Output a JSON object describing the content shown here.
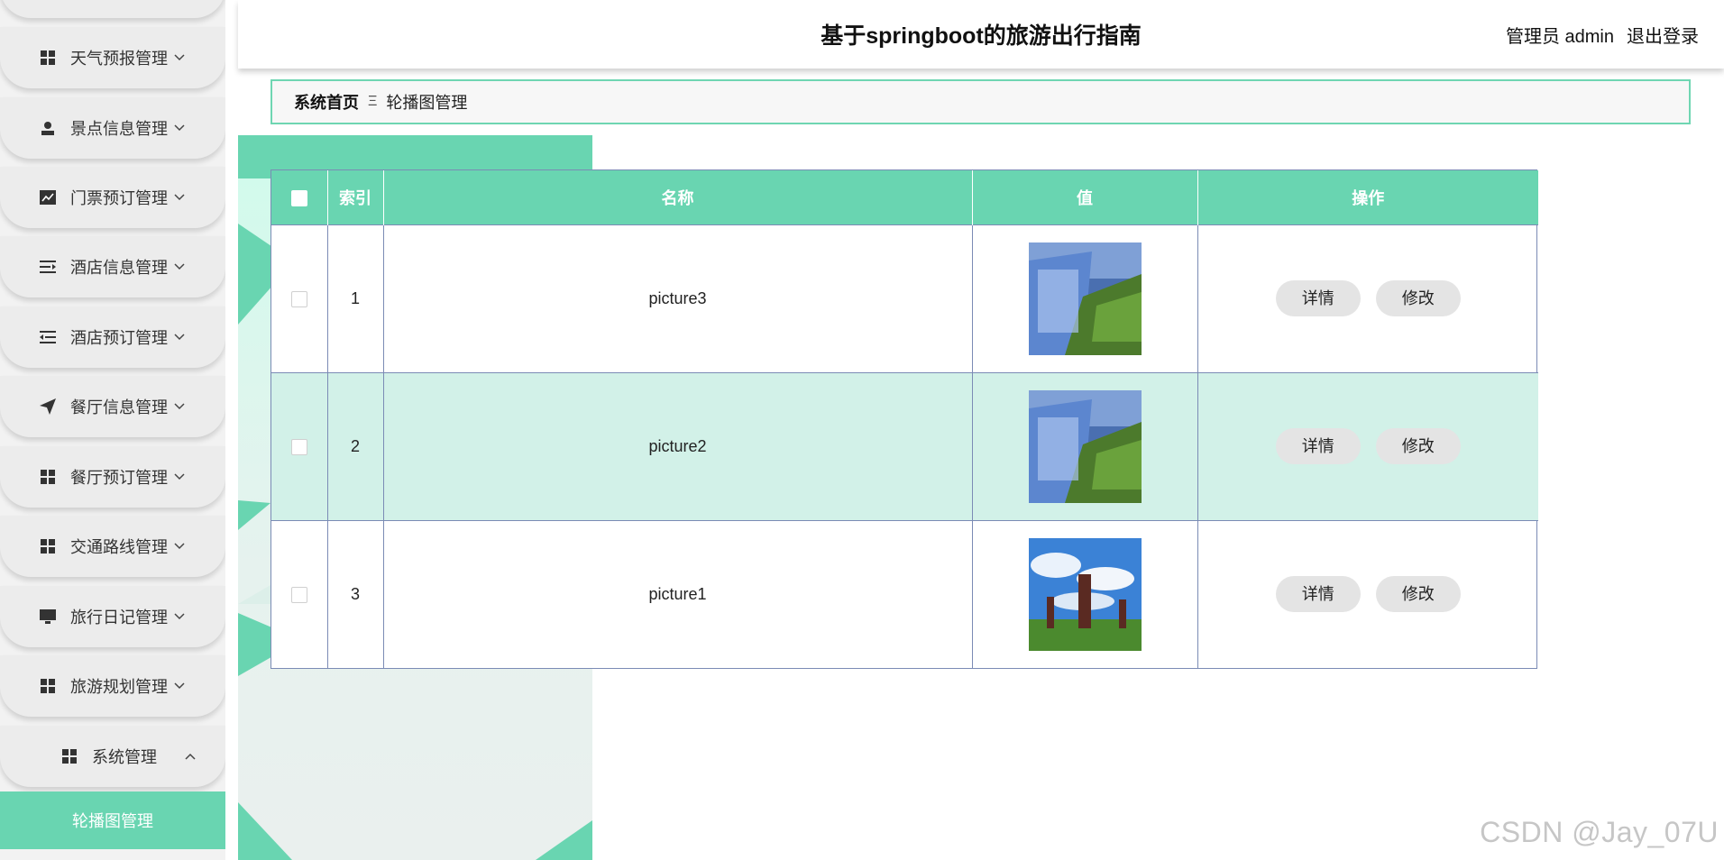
{
  "header": {
    "site_title": "基于springboot的旅游出行指南",
    "user_label": "管理员 admin",
    "logout_label": "退出登录"
  },
  "sidebar": {
    "items": [
      {
        "label": "天气预报管理",
        "icon": "grid-icon"
      },
      {
        "label": "景点信息管理",
        "icon": "user-icon"
      },
      {
        "label": "门票预订管理",
        "icon": "chart-icon"
      },
      {
        "label": "酒店信息管理",
        "icon": "list-indent-icon"
      },
      {
        "label": "酒店预订管理",
        "icon": "list-outdent-icon"
      },
      {
        "label": "餐厅信息管理",
        "icon": "send-icon"
      },
      {
        "label": "餐厅预订管理",
        "icon": "grid-icon"
      },
      {
        "label": "交通路线管理",
        "icon": "grid-icon"
      },
      {
        "label": "旅行日记管理",
        "icon": "monitor-icon"
      },
      {
        "label": "旅游规划管理",
        "icon": "grid-icon"
      },
      {
        "label": "系统管理",
        "icon": "grid-icon",
        "expanded": true
      }
    ],
    "active_sub": {
      "label": "轮播图管理"
    }
  },
  "breadcrumb": {
    "home": "系统首页",
    "separator": "Ξ",
    "current": "轮播图管理"
  },
  "table": {
    "columns": [
      "索引",
      "名称",
      "值",
      "操作"
    ],
    "rows": [
      {
        "index": "1",
        "name": "picture3",
        "image": "waterfall-image"
      },
      {
        "index": "2",
        "name": "picture2",
        "image": "waterfall-image"
      },
      {
        "index": "3",
        "name": "picture1",
        "image": "windmills-image"
      }
    ],
    "actions": {
      "detail": "详情",
      "edit": "修改"
    }
  },
  "watermark": "CSDN @Jay_07U",
  "colors": {
    "accent": "#69d5b1",
    "row_alt": "#d2f1e8",
    "button_bg": "#e4e4e4",
    "border": "#7b8bb5"
  }
}
